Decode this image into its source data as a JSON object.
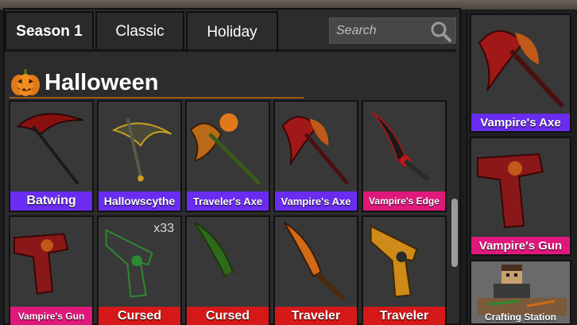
{
  "tabs": [
    {
      "label": "Season 1",
      "active": false
    },
    {
      "label": "Classic",
      "active": false
    },
    {
      "label": "Holiday",
      "active": true
    }
  ],
  "search": {
    "placeholder": "Search"
  },
  "section": {
    "title": "Halloween",
    "icon": "pumpkin-icon"
  },
  "colors": {
    "purple": "#6a2cf0",
    "pink": "#e0187c",
    "red": "#d61818",
    "panel": "#2c2c2c",
    "card": "#383838"
  },
  "items": [
    {
      "name": "Batwing",
      "tag": "purple",
      "icon": "scythe-icon"
    },
    {
      "name": "Hallowscythe",
      "tag": "purple",
      "icon": "scythe-icon"
    },
    {
      "name": "Traveler's Axe",
      "tag": "purple",
      "icon": "axe-icon"
    },
    {
      "name": "Vampire's Axe",
      "tag": "purple",
      "icon": "axe-icon"
    },
    {
      "name": "Vampire's Edge",
      "tag": "pink",
      "icon": "knife-icon"
    },
    {
      "name": "Vampire's Gun",
      "tag": "pink",
      "icon": "gun-icon"
    },
    {
      "name": "Cursed",
      "tag": "red",
      "icon": "gun-icon",
      "count": "x33"
    },
    {
      "name": "Cursed",
      "tag": "red",
      "icon": "knife-icon"
    },
    {
      "name": "Traveler",
      "tag": "red",
      "icon": "knife-icon"
    },
    {
      "name": "Traveler",
      "tag": "red",
      "icon": "gun-icon"
    }
  ],
  "side": [
    {
      "name": "Vampire's Axe",
      "tag": "purple",
      "icon": "axe-icon"
    },
    {
      "name": "Vampire's Gun",
      "tag": "pink",
      "icon": "gun-icon"
    },
    {
      "name": "Crafting Station",
      "tag": "none",
      "icon": "crafting-station-icon"
    }
  ]
}
